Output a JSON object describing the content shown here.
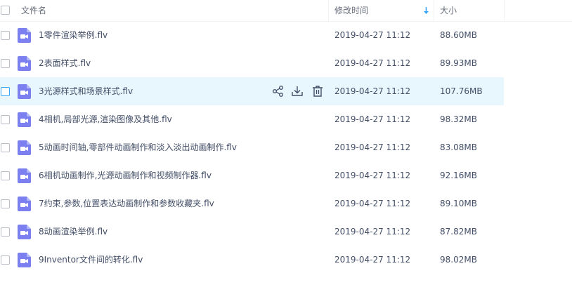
{
  "header": {
    "name_label": "文件名",
    "modified_label": "修改时间",
    "size_label": "大小",
    "sort_icon": "sort-down-arrow-icon"
  },
  "files": [
    {
      "name": "1零件渲染举例.flv",
      "modified": "2019-04-27 11:12",
      "size": "88.60MB",
      "icon": "video-file-icon"
    },
    {
      "name": "2表面样式.flv",
      "modified": "2019-04-27 11:12",
      "size": "89.93MB",
      "icon": "video-file-icon"
    },
    {
      "name": "3光源样式和场景样式.flv",
      "modified": "2019-04-27 11:12",
      "size": "107.76MB",
      "icon": "video-file-icon"
    },
    {
      "name": "4相机,局部光源,渲染图像及其他.flv",
      "modified": "2019-04-27 11:12",
      "size": "98.32MB",
      "icon": "video-file-icon"
    },
    {
      "name": "5动画时间轴,零部件动画制作和淡入淡出动画制作.flv",
      "modified": "2019-04-27 11:12",
      "size": "83.08MB",
      "icon": "video-file-icon"
    },
    {
      "name": "6相机动画制作,光源动画制作和视频制作器.flv",
      "modified": "2019-04-27 11:12",
      "size": "92.16MB",
      "icon": "video-file-icon"
    },
    {
      "name": "7约束,参数,位置表达动画制作和参数收藏夹.flv",
      "modified": "2019-04-27 11:12",
      "size": "89.10MB",
      "icon": "video-file-icon"
    },
    {
      "name": "8动画渲染举例.flv",
      "modified": "2019-04-27 11:12",
      "size": "87.82MB",
      "icon": "video-file-icon"
    },
    {
      "name": "9Inventor文件间的转化.flv",
      "modified": "2019-04-27 11:12",
      "size": "98.02MB",
      "icon": "video-file-icon"
    }
  ],
  "hover_actions": [
    "share-icon",
    "download-icon",
    "delete-icon"
  ],
  "colors": {
    "icon_purple": "#7b7ff0",
    "hover_bg": "#e8f6fe",
    "accent_blue": "#38a6f7"
  }
}
